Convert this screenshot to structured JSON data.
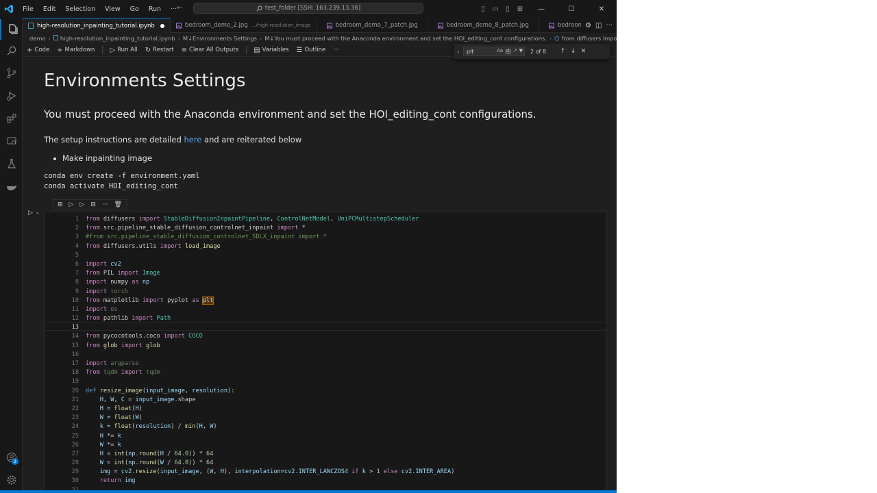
{
  "titlebar": {
    "menu": [
      "File",
      "Edit",
      "Selection",
      "View",
      "Go",
      "Run",
      "···"
    ],
    "search": "test_folder [SSH: 163.239.13.36]"
  },
  "tabs": [
    {
      "label": "high-resolution_inpainting_tutorial.ipynb",
      "desc": "",
      "active": true,
      "icon": "notebook-icon"
    },
    {
      "label": "bedroom_demo_2.jpg",
      "desc": ".../high-resolution_image",
      "active": false,
      "icon": "image-icon"
    },
    {
      "label": "bedroom_demo_7_patch.jpg",
      "desc": "",
      "active": false,
      "icon": "image-icon"
    },
    {
      "label": "bedroom_demo_8_patch.jpg",
      "desc": "",
      "active": false,
      "icon": "image-icon"
    },
    {
      "label": "bedroom_d",
      "desc": "",
      "active": false,
      "icon": "image-icon"
    }
  ],
  "breadcrumb": [
    "demo",
    "high-resolution_inpainting_tutorial.ipynb",
    "M↓Environments Settings",
    "M↓You must proceed with the Anaconda environment and set the HOI_editing_cont configurations.",
    "from diffusers import Stab"
  ],
  "toolbar": {
    "code": "Code",
    "markdown": "Markdown",
    "run_all": "Run All",
    "restart": "Restart",
    "clear_outputs": "Clear All Outputs",
    "variables": "Variables",
    "outline": "Outline",
    "more": "···"
  },
  "find": {
    "query": "plt",
    "count": "2 of 8",
    "opts": [
      "Aa",
      "ab",
      ".*"
    ]
  },
  "markdown": {
    "h1": "Environments Settings",
    "h2": "You must proceed with the Anaconda environment and set the HOI_editing_cont configurations.",
    "para_before": "The setup instructions are detailed ",
    "para_link": "here",
    "para_after": " and are reiterated below",
    "bullet": "Make inpainting image",
    "code_lines": [
      "conda env create -f environment.yaml",
      "conda activate HOI_editing_cont"
    ]
  },
  "code_line_numbers": [
    "1",
    "2",
    "3",
    "4",
    "5",
    "6",
    "7",
    "8",
    "9",
    "10",
    "11",
    "12",
    "13",
    "14",
    "15",
    "16",
    "17",
    "18",
    "19",
    "20",
    "21",
    "22",
    "23",
    "24",
    "25",
    "26",
    "27",
    "28",
    "29",
    "30",
    "31"
  ],
  "code_lines": [
    "from diffusers import StableDiffusionInpaintPipeline, ControlNetModel, UniPCMultistepScheduler",
    "from src.pipeline_stable_diffusion_controlnet_inpaint import *",
    "#from src.pipeline_stable_diffusion_controlnet_SDLX_inpaint import *",
    "from diffusers.utils import load_image",
    "",
    "import cv2",
    "from PIL import Image",
    "import numpy as np",
    "import torch",
    "from matplotlib import pyplot as plt",
    "import os",
    "from pathlib import Path",
    "",
    "from pycocotools.coco import COCO",
    "from glob import glob",
    "",
    "import argparse",
    "from tqdm import tqdm",
    "",
    "def resize_image(input_image, resolution):",
    "    H, W, C = input_image.shape",
    "    H = float(H)",
    "    W = float(W)",
    "    k = float(resolution) / min(H, W)",
    "    H *= k",
    "    W *= k",
    "    H = int(np.round(H / 64.0)) * 64",
    "    W = int(np.round(W / 64.0)) * 64",
    "    img = cv2.resize(input_image, (W, H), interpolation=cv2.INTER_LANCZOS4 if k > 1 else cv2.INTER_AREA)",
    "    return img",
    ""
  ],
  "account_badge": "2",
  "colors": {
    "accent": "#0078d4",
    "editor_bg": "#1f1f1f",
    "cell_bg": "#181818",
    "keyword": "#c586c0",
    "function": "#dcdcaa",
    "variable": "#9cdcfe",
    "class": "#4ec9b0",
    "number": "#b5cea8",
    "comment": "#6a9955",
    "link": "#4daafc",
    "find_match": "#613214"
  }
}
